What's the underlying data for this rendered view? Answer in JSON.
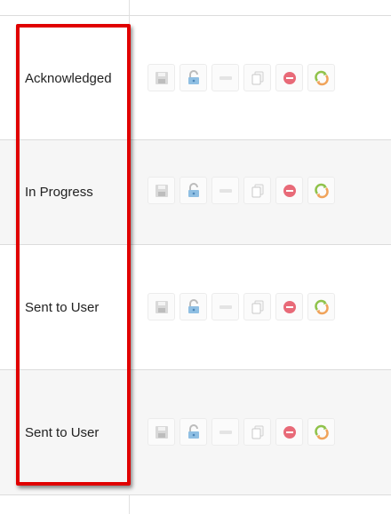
{
  "rows": [
    {
      "status": "Acknowledged"
    },
    {
      "status": "In Progress"
    },
    {
      "status": "Sent to User"
    },
    {
      "status": "Sent to User"
    }
  ],
  "icons": [
    "save-icon",
    "unlock-icon",
    "minus-bar-icon",
    "copy-icon",
    "stop-icon",
    "refresh-icon"
  ],
  "colors": {
    "highlight": "#e00000",
    "stop": "#e86a78",
    "refresh_green": "#8fc24a",
    "refresh_orange": "#f0a35a",
    "lock_blue": "#6aa8d8"
  }
}
